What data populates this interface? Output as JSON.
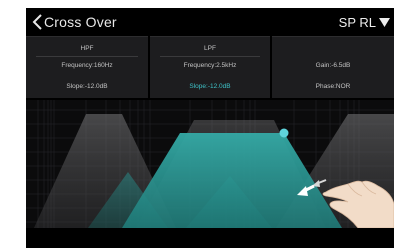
{
  "header": {
    "title": "Cross Over",
    "channel_label": "SP RL"
  },
  "panels": {
    "hpf": {
      "heading": "HPF",
      "frequency": "Frequency:160Hz",
      "slope": "Slope:-12.0dB"
    },
    "lpf": {
      "heading": "LPF",
      "frequency": "Frequency:2.5kHz",
      "slope": "Slope:-12.0dB"
    },
    "gain": {
      "heading": "",
      "gain": "Gain:-6.5dB",
      "phase": "Phase:NOR"
    }
  },
  "colors": {
    "accent": "#3ec2c8",
    "filter_fill": "#2a9b98",
    "inactive_filter": "#5a5a5c",
    "background": "#000000",
    "panel": "#1d1d1f"
  },
  "icons": {
    "back": "chevron-left-icon",
    "dropdown": "triangle-down-icon",
    "handle": "drag-handle-icon",
    "gesture": "swipe-hand-icon"
  }
}
